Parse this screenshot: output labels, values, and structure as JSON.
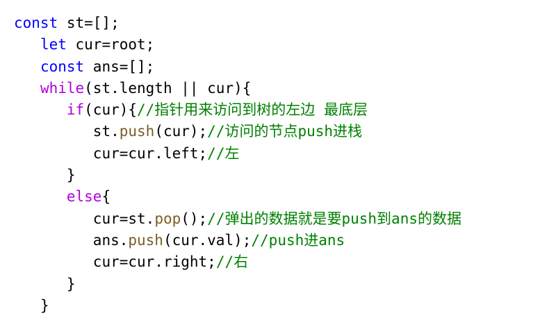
{
  "editor": {
    "lines": [
      {
        "indent": 0,
        "tokens": [
          {
            "type": "kw",
            "text": "const"
          },
          {
            "type": "plain",
            "text": " st=[];"
          }
        ]
      },
      {
        "indent": 1,
        "tokens": [
          {
            "type": "kw",
            "text": "let"
          },
          {
            "type": "plain",
            "text": " cur=root;"
          }
        ]
      },
      {
        "indent": 1,
        "tokens": [
          {
            "type": "kw",
            "text": "const"
          },
          {
            "type": "plain",
            "text": " ans=[];"
          }
        ]
      },
      {
        "indent": 1,
        "tokens": [
          {
            "type": "ctrl",
            "text": "while"
          },
          {
            "type": "plain",
            "text": "(st.length || cur){"
          }
        ]
      },
      {
        "indent": 2,
        "tokens": [
          {
            "type": "ctrl",
            "text": "if"
          },
          {
            "type": "plain",
            "text": "(cur){"
          },
          {
            "type": "comment",
            "text": "//指针用来访问到树的左边 最底层"
          }
        ]
      },
      {
        "indent": 3,
        "tokens": [
          {
            "type": "plain",
            "text": "st."
          },
          {
            "type": "fn",
            "text": "push"
          },
          {
            "type": "plain",
            "text": "(cur);"
          },
          {
            "type": "comment",
            "text": "//访问的节点push进栈"
          }
        ]
      },
      {
        "indent": 3,
        "tokens": [
          {
            "type": "plain",
            "text": "cur=cur.left;"
          },
          {
            "type": "comment",
            "text": "//左"
          }
        ]
      },
      {
        "indent": 2,
        "tokens": [
          {
            "type": "plain",
            "text": "}"
          }
        ]
      },
      {
        "indent": 2,
        "tokens": [
          {
            "type": "ctrl",
            "text": "else"
          },
          {
            "type": "plain",
            "text": "{"
          }
        ]
      },
      {
        "indent": 3,
        "tokens": [
          {
            "type": "plain",
            "text": "cur=st."
          },
          {
            "type": "fn",
            "text": "pop"
          },
          {
            "type": "plain",
            "text": "();"
          },
          {
            "type": "comment",
            "text": "//弹出的数据就是要push到ans的数据"
          }
        ]
      },
      {
        "indent": 3,
        "tokens": [
          {
            "type": "plain",
            "text": "ans."
          },
          {
            "type": "fn",
            "text": "push"
          },
          {
            "type": "plain",
            "text": "(cur.val);"
          },
          {
            "type": "comment",
            "text": "//push进ans"
          }
        ]
      },
      {
        "indent": 3,
        "tokens": [
          {
            "type": "plain",
            "text": "cur=cur.right;"
          },
          {
            "type": "comment",
            "text": "//右"
          }
        ]
      },
      {
        "indent": 2,
        "tokens": [
          {
            "type": "plain",
            "text": "}"
          }
        ]
      },
      {
        "indent": 1,
        "tokens": [
          {
            "type": "plain",
            "text": "}"
          }
        ]
      }
    ]
  },
  "colors": {
    "keyword": "#0000ff",
    "control": "#af00db",
    "function": "#795e26",
    "comment": "#008000",
    "text": "#000000",
    "background": "#ffffff"
  }
}
